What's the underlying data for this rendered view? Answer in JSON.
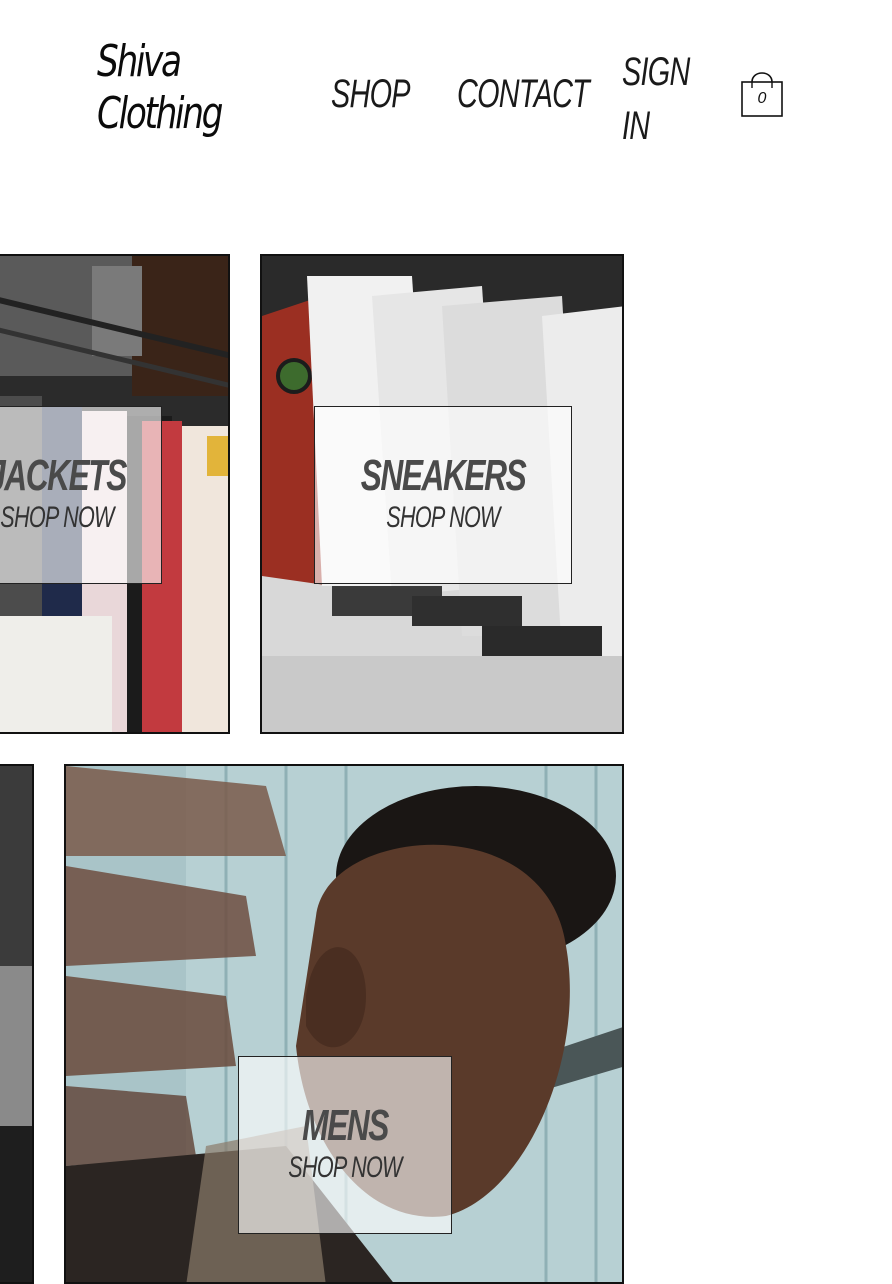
{
  "header": {
    "logo_line1": "Shiva",
    "logo_line2": "Clothing",
    "nav": {
      "shop": "SHOP",
      "contact": "CONTACT",
      "signin_line1": "SIGN",
      "signin_line2": "IN"
    },
    "cart_count": "0",
    "cart_icon": "shopping-bag-icon"
  },
  "categories": [
    {
      "title": "JACKETS",
      "cta": "SHOP NOW"
    },
    {
      "title": "SNEAKERS",
      "cta": "SHOP NOW"
    },
    {
      "title": "MENS",
      "cta": "SHOP NOW"
    }
  ],
  "colors": {
    "text": "#111111",
    "label_title": "#4a4a4a",
    "label_bg": "rgba(255,255,255,0.62)"
  }
}
